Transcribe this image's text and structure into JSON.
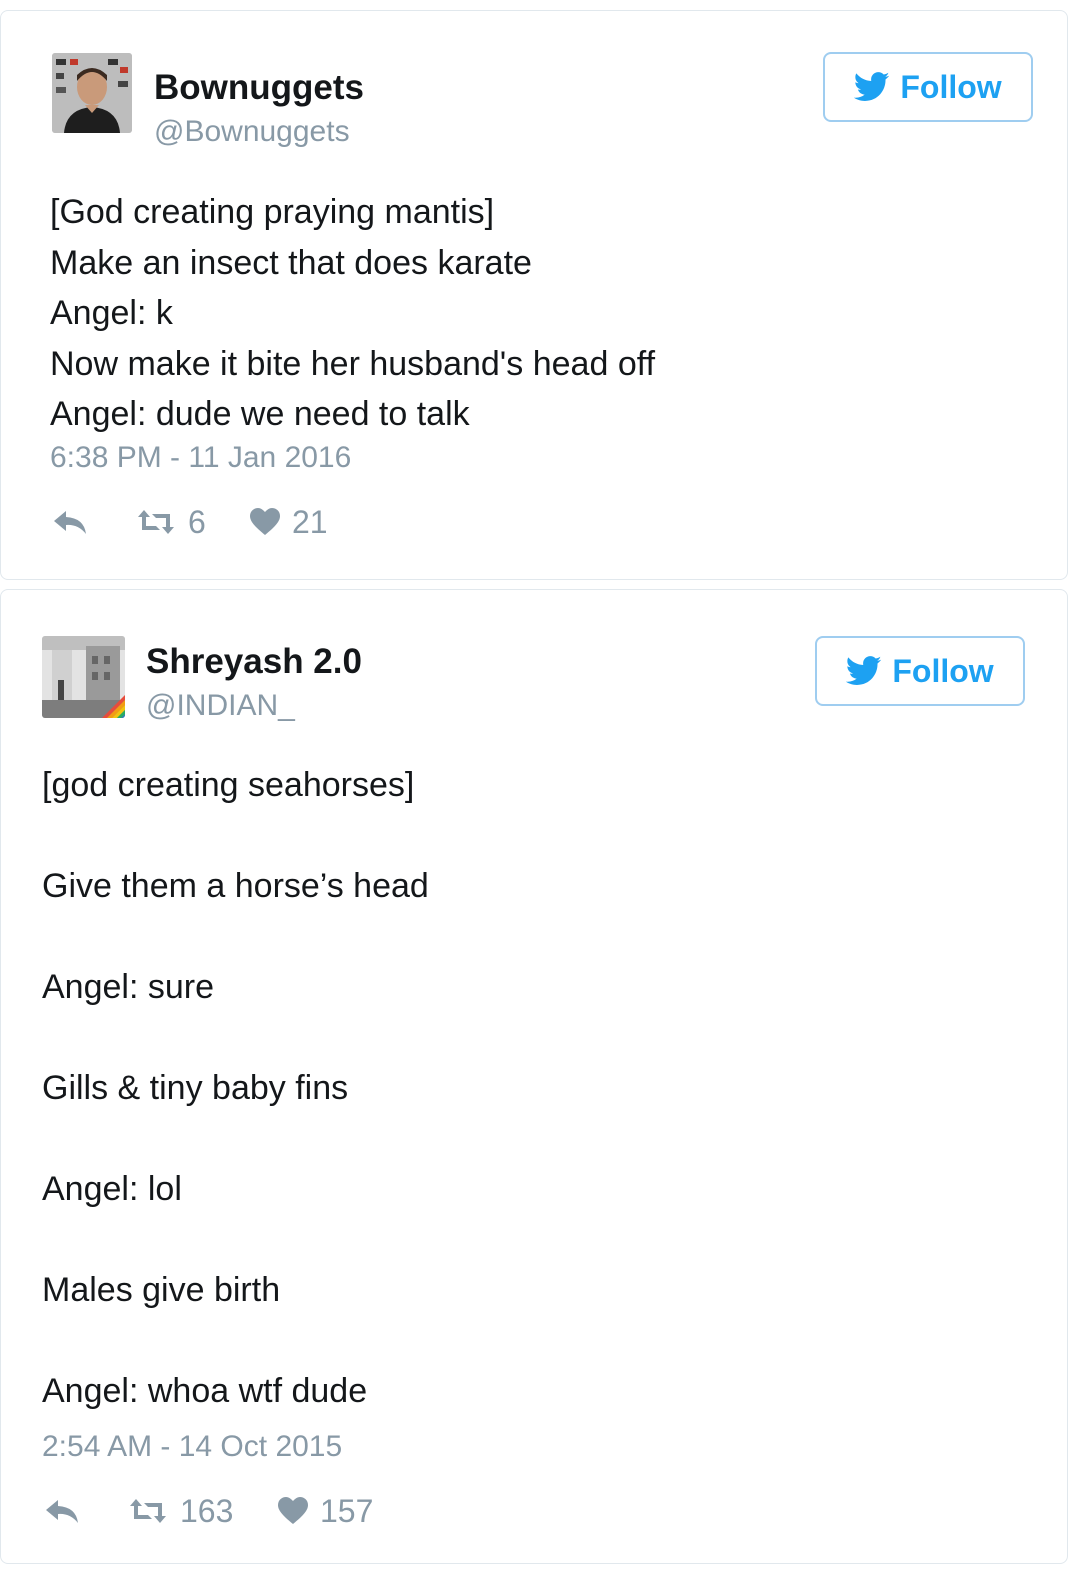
{
  "tweets": [
    {
      "author": {
        "name": "Bownuggets",
        "handle": "@Bownuggets"
      },
      "follow_label": "Follow",
      "lines": [
        "[God creating praying mantis]",
        "Make an insect that does karate",
        "Angel: k",
        "Now make it bite her husband's head off",
        "Angel: dude we need to talk"
      ],
      "timestamp": "6:38 PM - 11 Jan 2016",
      "retweets": "6",
      "likes": "21"
    },
    {
      "author": {
        "name": "Shreyash 2.0",
        "handle": "@INDIAN_"
      },
      "follow_label": "Follow",
      "lines": [
        "[god creating seahorses]",
        "Give them a horse’s head",
        "Angel: sure",
        "Gills & tiny baby fins",
        "Angel: lol",
        "Males give birth",
        "Angel: whoa wtf dude"
      ],
      "timestamp": "2:54 AM - 14 Oct 2015",
      "retweets": "163",
      "likes": "157"
    }
  ],
  "colors": {
    "twitter_blue": "#1da1f2",
    "follow_border": "#9fcdf0",
    "meta_gray": "#8899a6",
    "text": "#14171a",
    "card_border": "#e1e8ed"
  },
  "icons": {
    "follow": "twitter-bird-icon",
    "reply": "reply-icon",
    "retweet": "retweet-icon",
    "like": "heart-icon"
  }
}
